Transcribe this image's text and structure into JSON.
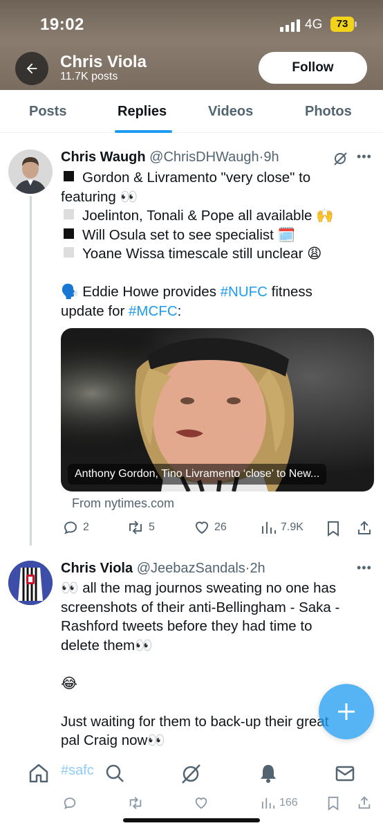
{
  "status_bar": {
    "time": "19:02",
    "network": "4G",
    "battery": "73"
  },
  "profile": {
    "name": "Chris Viola",
    "posts_count": "11.7K posts",
    "follow_label": "Follow"
  },
  "tabs": [
    {
      "label": "Posts"
    },
    {
      "label": "Replies",
      "active": true
    },
    {
      "label": "Videos"
    },
    {
      "label": "Photos"
    }
  ],
  "tweet1": {
    "name": "Chris Waugh",
    "handle": "@ChrisDHWaugh",
    "sep": "·",
    "time": "9h",
    "lines": {
      "l1": "Gordon & Livramento \"very close\" to",
      "l2": "featuring 👀",
      "l3": "Joelinton, Tonali & Pope all available 🙌",
      "l4": "Will Osula set to see specialist 🗓️",
      "l5": "Yoane Wissa timescale still unclear 😩",
      "l6a": "🗣️  Eddie Howe provides ",
      "l6b": "#NUFC",
      "l6c": " fitness",
      "l7a": "update for ",
      "l7b": "#MCFC",
      "l7c": ":"
    },
    "link_card": {
      "caption": "Anthony Gordon, Tino Livramento ‘close’ to New...",
      "source": "From nytimes.com"
    },
    "stats": {
      "replies": "2",
      "reposts": "5",
      "likes": "26",
      "views": "7.9K"
    }
  },
  "tweet2": {
    "name": "Chris Viola",
    "handle": "@JeebazSandals",
    "sep": "·",
    "time": "2h",
    "lines": {
      "l1": "👀 all the mag journos sweating no one has",
      "l2": "screenshots of their anti-Bellingham - Saka -",
      "l3": "Rashford tweets before they had time to",
      "l4": "delete them👀",
      "l5": "😂",
      "l6": "Just waiting for them to back-up their great",
      "l7": "pal Craig now👀"
    },
    "stats": {
      "views": "166"
    }
  },
  "bottom_nav": {
    "hashtag": "#safc"
  },
  "colors": {
    "accent": "#1d9bf0",
    "secondary_text": "#536471",
    "battery": "#f2d21a"
  }
}
